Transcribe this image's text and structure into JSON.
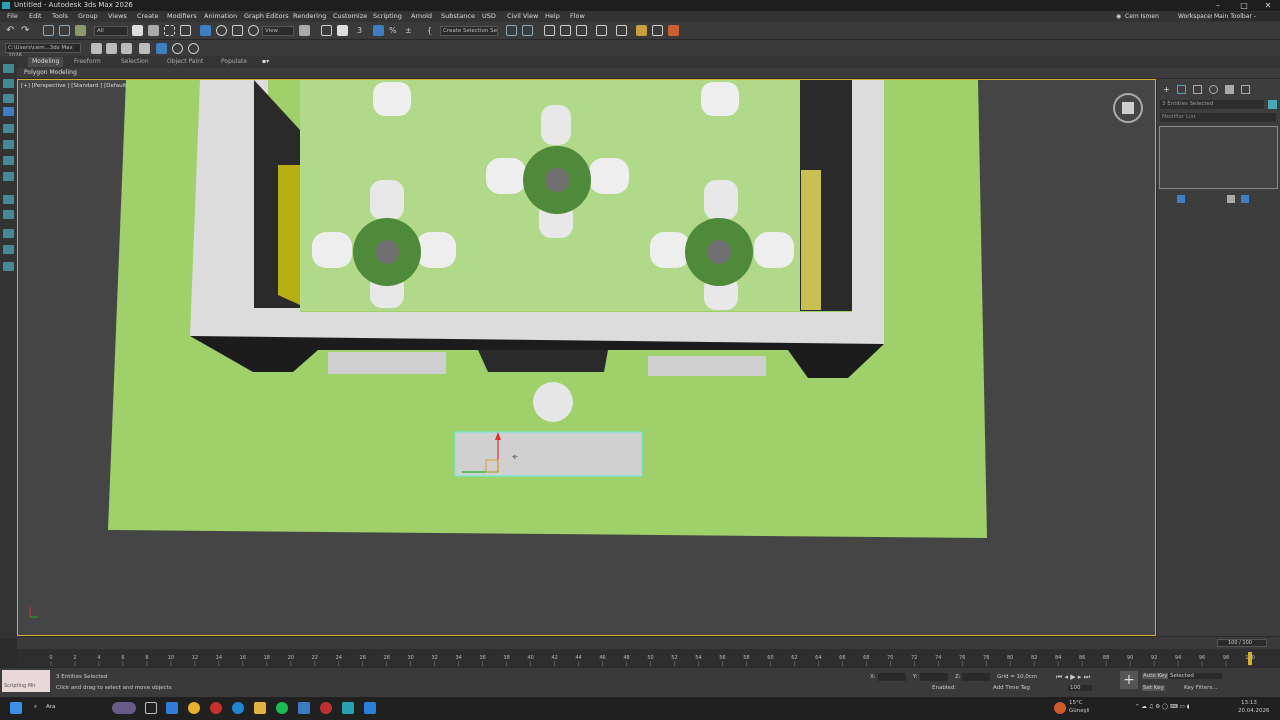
{
  "window": {
    "title": "Untitled - Autodesk 3ds Max 2026"
  },
  "menu": {
    "items": [
      "File",
      "Edit",
      "Tools",
      "Group",
      "Views",
      "Create",
      "Modifiers",
      "Animation",
      "Graph Editors",
      "Rendering",
      "Customize",
      "Scripting",
      "Arnold",
      "Substance",
      "USD",
      "Civil View",
      "Help",
      "Flow"
    ],
    "user": "Cem Ismen",
    "workspaces_label": "Workspaces:",
    "workspace_value": "Main Toolbar - modular"
  },
  "toolbar": {
    "filter_value": "All",
    "refcoord_value": "View",
    "selection_set_placeholder": "Create Selection Se"
  },
  "toolbar2": {
    "path_value": "C:\\Users\\cem...3ds Max 2026"
  },
  "ribbon": {
    "tabs": [
      "Modeling",
      "Freeform",
      "Selection",
      "Object Paint",
      "Populate"
    ],
    "subpanel": "Polygon Modeling"
  },
  "viewport": {
    "label": "[+] [Perspective ] [Standard ] [Default Shading ]"
  },
  "command_panel": {
    "selected_text": "3 Entities Selected",
    "modifier_list": "Modifier List"
  },
  "trackbar": {
    "frame_display": "100 / 100"
  },
  "timeline": {
    "ticks": [
      "0",
      "2",
      "4",
      "6",
      "8",
      "10",
      "12",
      "14",
      "16",
      "18",
      "20",
      "22",
      "24",
      "26",
      "28",
      "30",
      "32",
      "34",
      "36",
      "38",
      "40",
      "42",
      "44",
      "46",
      "48",
      "50",
      "52",
      "54",
      "56",
      "58",
      "60",
      "62",
      "64",
      "66",
      "68",
      "70",
      "72",
      "74",
      "76",
      "78",
      "80",
      "82",
      "84",
      "86",
      "88",
      "90",
      "92",
      "94",
      "96",
      "98",
      "100"
    ]
  },
  "status": {
    "maxscript_label": "Scripting Mir",
    "selected": "3 Entities Selected",
    "prompt": "Click and drag to select and move objects",
    "x_label": "X:",
    "y_label": "Y:",
    "z_label": "Z:",
    "grid": "Grid = 10,0cm",
    "enabled_label": "Enabled:",
    "add_time_tag": "Add Time Tag",
    "auto_key": "Auto Key",
    "set_key": "Set Key",
    "selected_dropdown": "Selected",
    "key_filters": "Key Filters...",
    "frame_field": "100"
  },
  "taskbar": {
    "search_placeholder": "Ara",
    "weather_temp": "15°C",
    "weather_desc": "Güneşli",
    "time": "13:13",
    "date": "20.04.2026"
  },
  "colors": {
    "accent": "#2aa1b3",
    "viewport_border": "#d4b030",
    "floor_green": "#9fd06a",
    "wall": "#dcdcdc"
  }
}
